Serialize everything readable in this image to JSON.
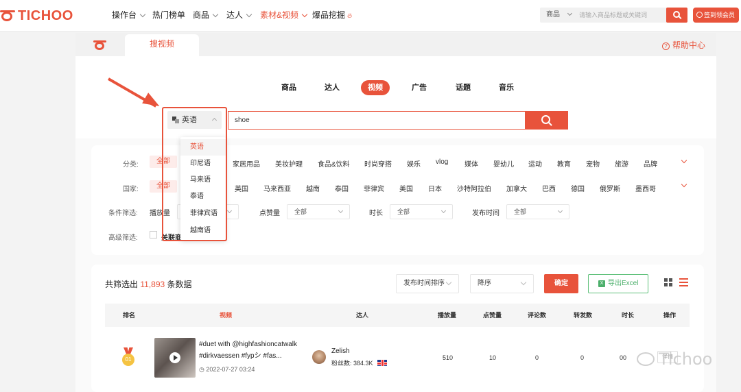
{
  "brand": {
    "name": "TICHOO",
    "accent": "#e8533b"
  },
  "nav": {
    "items": [
      {
        "label": "操作台",
        "has_caret": true
      },
      {
        "label": "热门榜单",
        "has_caret": false
      },
      {
        "label": "商品",
        "has_caret": true
      },
      {
        "label": "达人",
        "has_caret": true
      },
      {
        "label": "素材&视频",
        "has_caret": true,
        "active": true
      },
      {
        "label": "爆品挖掘",
        "has_caret": false,
        "hot": true
      }
    ],
    "search": {
      "scope": "商品",
      "placeholder": "请输入商品标题或关键词"
    },
    "sign_button": "签到领会员"
  },
  "page": {
    "tab": "搜视频",
    "help": "帮助中心",
    "type_tabs": [
      "商品",
      "达人",
      "视频",
      "广告",
      "话题",
      "音乐"
    ],
    "active_type": "视频",
    "language": "英语",
    "query": "shoe",
    "language_options": [
      "英语",
      "印尼语",
      "马来语",
      "泰语",
      "菲律宾语",
      "越南语"
    ]
  },
  "filters": {
    "category_label": "分类:",
    "categories": [
      "全部",
      "家居用品",
      "美妆护理",
      "食品&饮料",
      "时尚穿搭",
      "娱乐",
      "vlog",
      "媒体",
      "婴幼儿",
      "运动",
      "教育",
      "宠物",
      "旅游",
      "品牌"
    ],
    "country_label": "国家:",
    "countries": [
      "全部",
      "英国",
      "马来西亚",
      "越南",
      "泰国",
      "菲律宾",
      "美国",
      "日本",
      "沙特阿拉伯",
      "加拿大",
      "巴西",
      "德国",
      "俄罗斯",
      "墨西哥"
    ],
    "condition_label": "条件筛选:",
    "play_label": "播放量",
    "likes_label": "点赞量",
    "likes_value": "全部",
    "duration_label": "时长",
    "duration_value": "全部",
    "publish_label": "发布时间",
    "publish_value": "全部",
    "advanced_label": "高级筛选:",
    "advanced_check": "关联商"
  },
  "results": {
    "prefix": "共筛选出",
    "count": "11,893",
    "suffix": "条数据",
    "sort_field": "发布时间排序",
    "sort_order": "降序",
    "confirm": "确定",
    "export": "导出Excel",
    "columns": [
      "排名",
      "视频",
      "达人",
      "播放量",
      "点赞量",
      "评论数",
      "转发数",
      "时长",
      "操作"
    ],
    "rows": [
      {
        "rank": "01",
        "title": "#duet with @highfashioncatwalk #dirkvaessen #fypシ #fas...",
        "date": "2022-07-27 03:24",
        "creator": "Zelish",
        "fans_label": "粉丝数:",
        "fans": "384.3K",
        "plays": "510",
        "likes": "10",
        "comments": "0",
        "shares": "0",
        "duration": "00",
        "op": "详情"
      }
    ]
  },
  "watermark": "Tichoo"
}
